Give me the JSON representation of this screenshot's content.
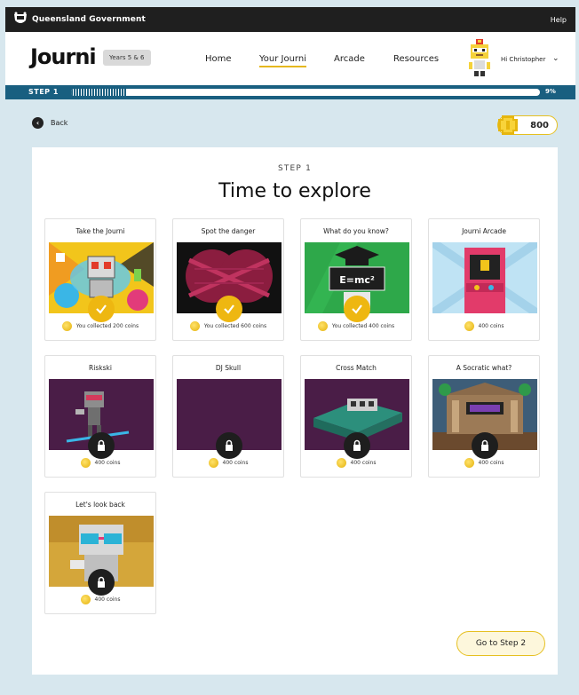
{
  "gov": {
    "name": "Queensland Government",
    "help": "Help"
  },
  "header": {
    "logo": "Journi",
    "years": "Years 5 & 6",
    "nav": [
      "Home",
      "Your Journi",
      "Arcade",
      "Resources"
    ],
    "active_nav": "Your Journi",
    "greeting": "Hi Christopher",
    "caret": "⌄"
  },
  "progress": {
    "label": "STEP 1",
    "percent_text": "9%",
    "value": 0.12
  },
  "back_label": "Back",
  "coins_total": "800",
  "step": {
    "label": "STEP 1",
    "title": "Time to explore"
  },
  "cards": [
    {
      "title": "Take the Journi",
      "footer": "You collected 200 coins",
      "status": "complete"
    },
    {
      "title": "Spot the danger",
      "footer": "You collected 600 coins",
      "status": "complete"
    },
    {
      "title": "What do you know?",
      "footer": "You collected 400 coins",
      "status": "complete"
    },
    {
      "title": "Journi Arcade",
      "footer": "400 coins",
      "status": "open"
    },
    {
      "title": "Riskski",
      "footer": "400 coins",
      "status": "locked"
    },
    {
      "title": "DJ Skull",
      "footer": "400 coins",
      "status": "locked"
    },
    {
      "title": "Cross Match",
      "footer": "400 coins",
      "status": "locked"
    },
    {
      "title": "A Socratic what?",
      "footer": "400 coins",
      "status": "locked"
    },
    {
      "title": "Let's look back",
      "footer": "400 coins",
      "status": "locked"
    }
  ],
  "emc_text": "E=mc²",
  "next_button": "Go to Step 2",
  "colors": {
    "brand_blue": "#195f80",
    "accent_gold": "#e6c020",
    "purple": "#4a1d47"
  }
}
